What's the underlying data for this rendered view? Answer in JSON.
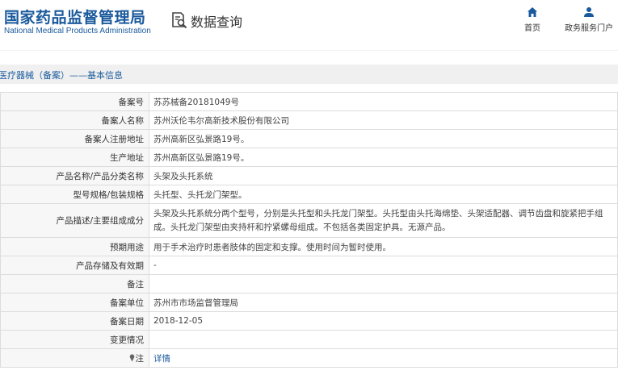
{
  "header": {
    "logo_cn": "国家药品监督管理局",
    "logo_en": "National Medical Products Administration",
    "query_title": "数据查询",
    "query_icon": "search-document-icon",
    "nav": [
      {
        "label": "首页",
        "icon": "home-icon"
      },
      {
        "label": "政务服务门户",
        "icon": "user-icon"
      }
    ],
    "brand_color": "#1a5a9c"
  },
  "breadcrumb": "医疗器械（备案）——基本信息",
  "details": [
    {
      "label": "备案号",
      "value": "苏苏械备20181049号"
    },
    {
      "label": "备案人名称",
      "value": "苏州沃伦韦尔高新技术股份有限公司"
    },
    {
      "label": "备案人注册地址",
      "value": "苏州高新区弘景路19号。"
    },
    {
      "label": "生产地址",
      "value": "苏州高新区弘景路19号。"
    },
    {
      "label": "产品名称/产品分类名称",
      "value": "头架及头托系统"
    },
    {
      "label": "型号规格/包装规格",
      "value": "头托型、头托龙门架型。"
    },
    {
      "label": "产品描述/主要组成成分",
      "value": "头架及头托系统分两个型号，分别是头托型和头托龙门架型。头托型由头托海绵垫、头架适配器、调节齿盘和旋紧把手组成。头托龙门架型由夹持杆和拧紧螺母组成。不包括各类固定护具。无源产品。"
    },
    {
      "label": "预期用途",
      "value": "用于手术治疗时患者肢体的固定和支撑。使用时间为暂时使用。"
    },
    {
      "label": "产品存储及有效期",
      "value": "-"
    },
    {
      "label": "备注",
      "value": ""
    },
    {
      "label": "备案单位",
      "value": "苏州市市场监督管理局"
    },
    {
      "label": "备案日期",
      "value": "2018-12-05"
    },
    {
      "label": "变更情况",
      "value": ""
    }
  ],
  "note": {
    "label": "注",
    "link_text": "详情",
    "icon": "pin-icon"
  }
}
